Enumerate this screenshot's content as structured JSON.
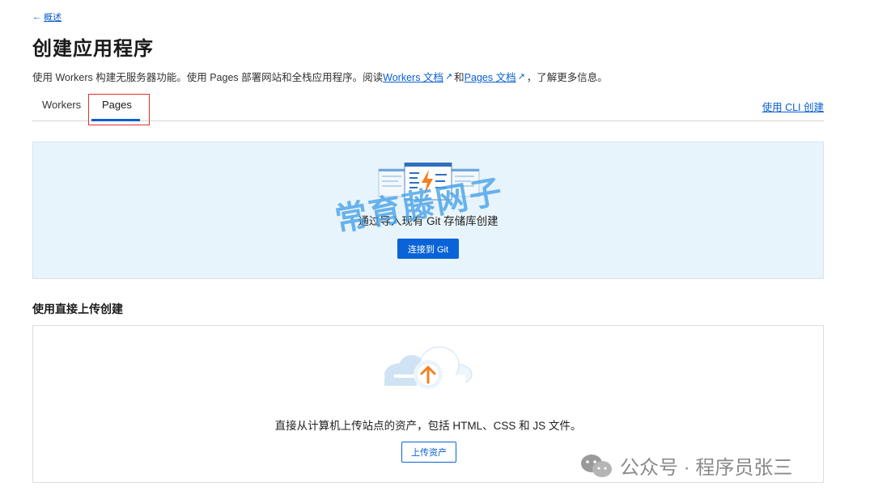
{
  "nav": {
    "back_label": "概述",
    "back_arrow": "←"
  },
  "header": {
    "title": "创建应用程序"
  },
  "description": {
    "prefix": "使用 Workers 构建无服务器功能。使用 Pages 部署网站和全栈应用程序。阅读 ",
    "workers_link": "Workers 文档",
    "middle": "和 ",
    "pages_link": "Pages 文档",
    "suffix": "，了解更多信息。",
    "external_icon": "↗"
  },
  "tabs": [
    {
      "label": "Workers",
      "active": false
    },
    {
      "label": "Pages",
      "active": true
    }
  ],
  "cli_link": "使用 CLI 创建",
  "git_section": {
    "text": "通过导入现有 Git 存储库创建",
    "button": "连接到 Git"
  },
  "watermark": "常育藤网子",
  "upload_section": {
    "heading": "使用直接上传创建",
    "text": "直接从计算机上传站点的资产，包括 HTML、CSS 和 JS 文件。",
    "button": "上传资产"
  },
  "footer": {
    "text": "公众号 · 程序员张三"
  },
  "colors": {
    "accent": "#0a63d8",
    "panel_bg": "#e8f4fb",
    "highlight": "#e0302c",
    "orange": "#f38020"
  }
}
